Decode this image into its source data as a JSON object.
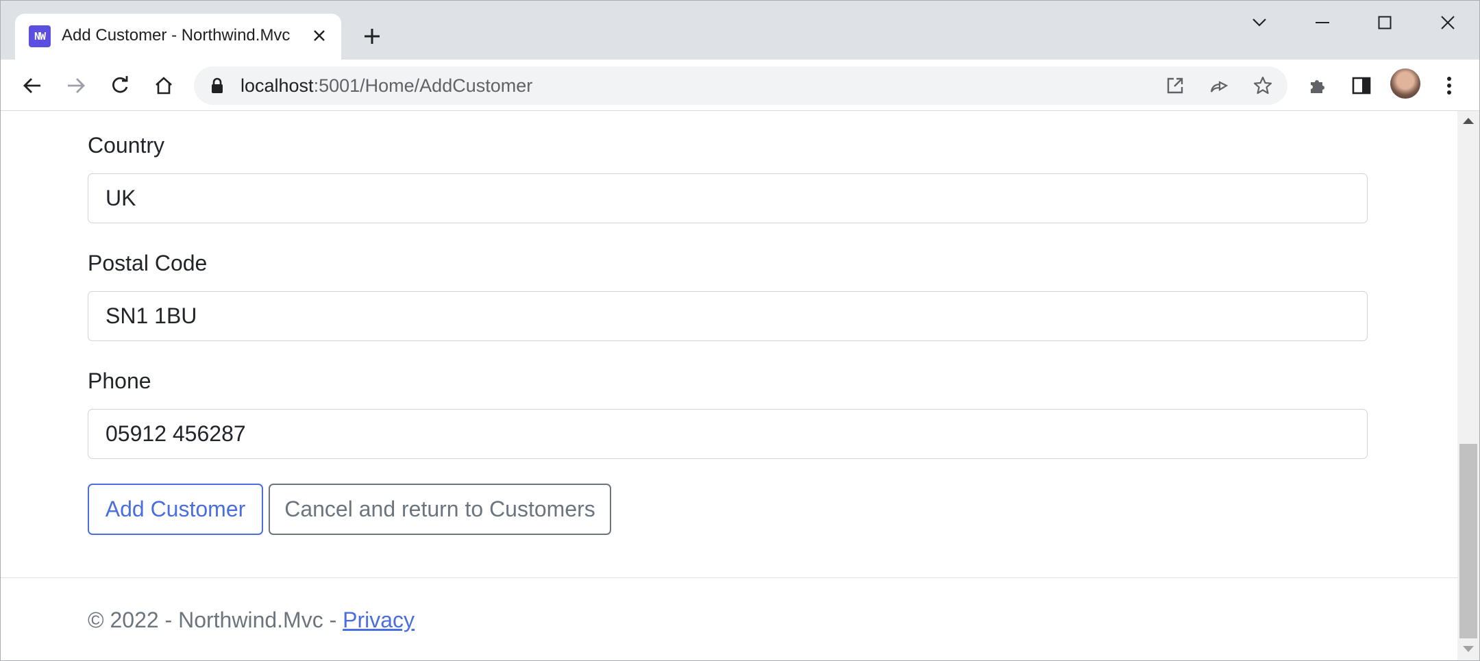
{
  "tab": {
    "title": "Add Customer - Northwind.Mvc",
    "favicon_text": "NW"
  },
  "address_bar": {
    "host": "localhost",
    "rest": ":5001/Home/AddCustomer"
  },
  "form": {
    "country": {
      "label": "Country",
      "value": "UK"
    },
    "postal_code": {
      "label": "Postal Code",
      "value": "SN1 1BU"
    },
    "phone": {
      "label": "Phone",
      "value": "05912 456287"
    },
    "submit_label": "Add Customer",
    "cancel_label": "Cancel and return to Customers"
  },
  "footer": {
    "text": "© 2022 - Northwind.Mvc - ",
    "privacy_link": "Privacy"
  },
  "colors": {
    "accent": "#4a6ee0",
    "favicon_bg": "#5b4ee0",
    "tabstrip": "#dee1e6"
  }
}
